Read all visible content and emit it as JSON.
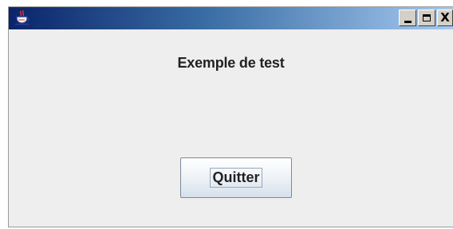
{
  "window": {
    "title": "",
    "app_icon": "java-coffee-cup-icon",
    "controls": {
      "minimize": "_",
      "maximize": "□",
      "close": "X"
    }
  },
  "content": {
    "heading": "Exemple de test",
    "quit_label": "Quitter"
  },
  "colors": {
    "titlebar_start": "#0a246a",
    "titlebar_end": "#a6caf0",
    "window_bg": "#eeeeee",
    "text": "#222222"
  }
}
